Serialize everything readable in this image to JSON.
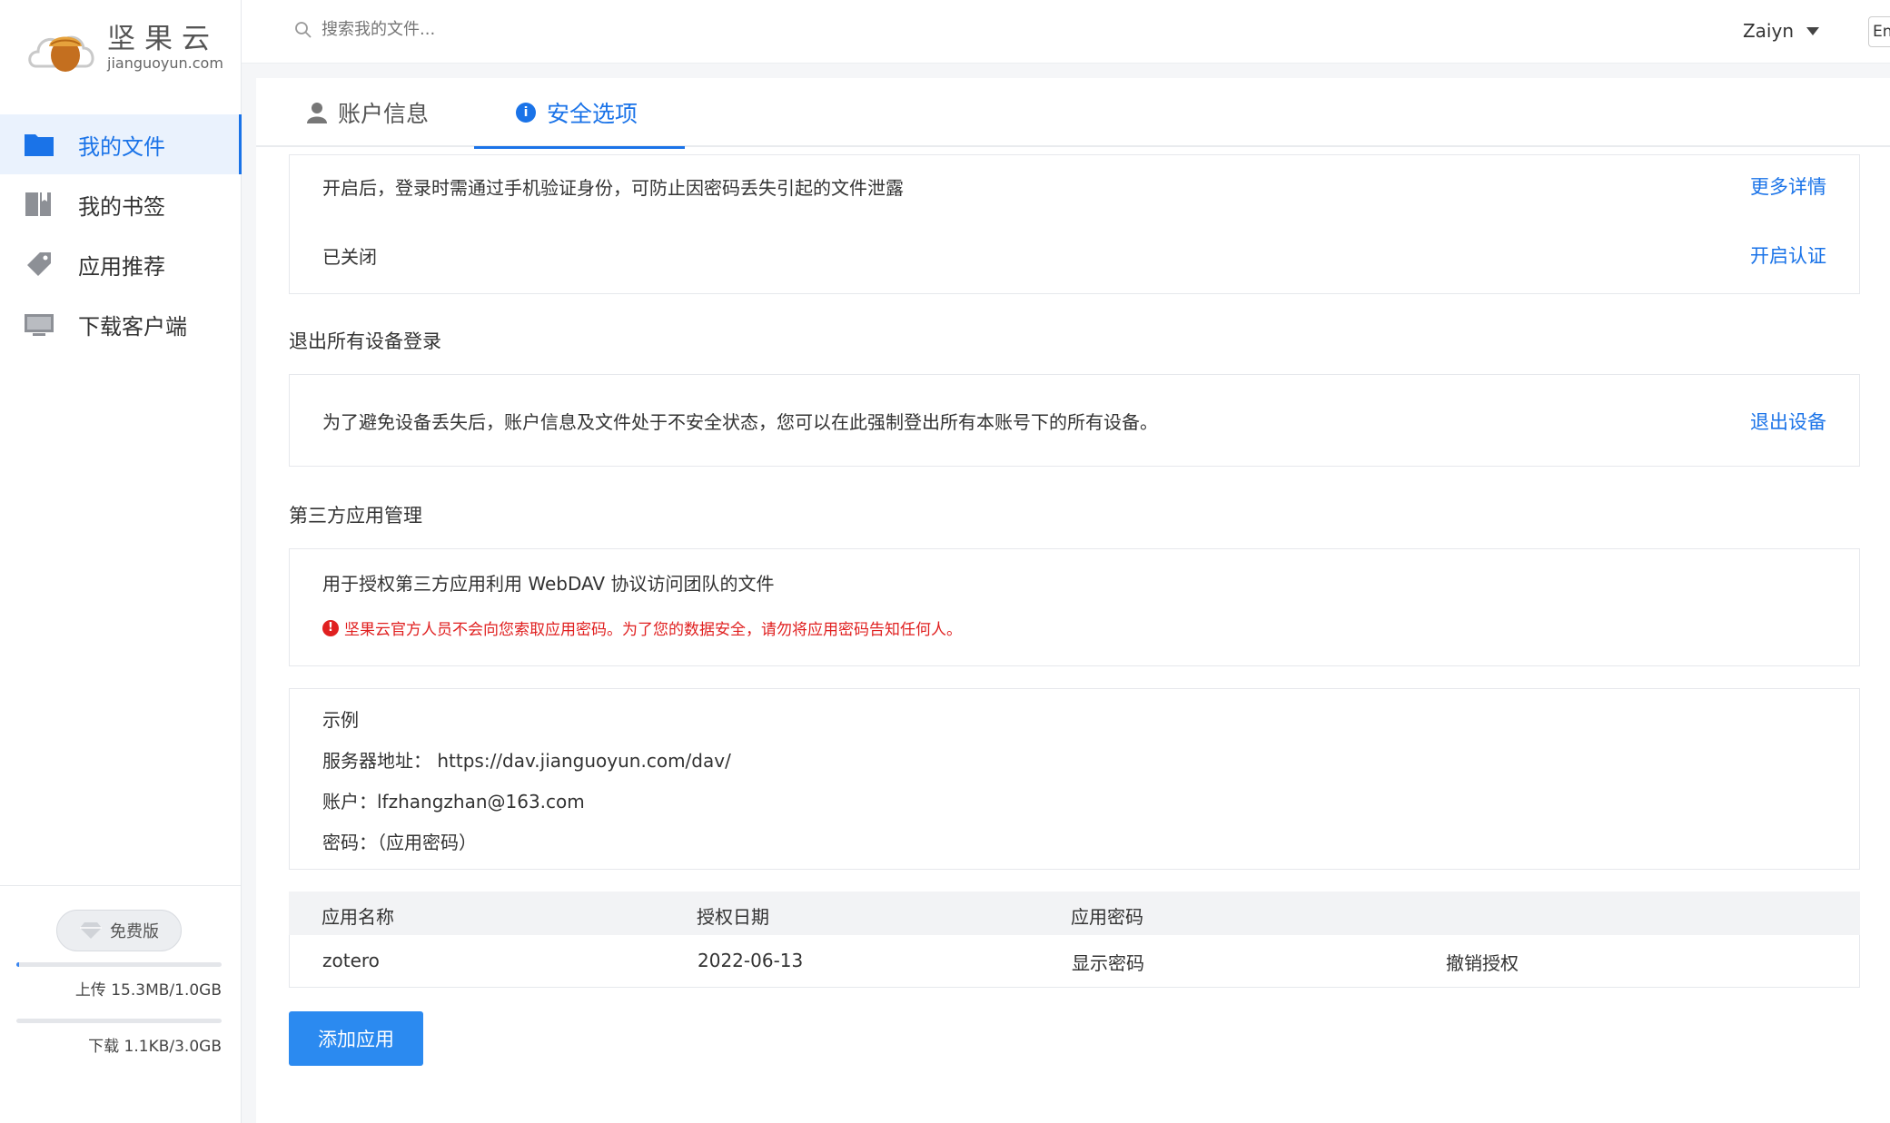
{
  "brand": {
    "name_cn": "坚果云",
    "name_en": "jianguoyun.com"
  },
  "sidebar": {
    "items": [
      {
        "label": "我的文件",
        "icon": "folder-icon",
        "active": true
      },
      {
        "label": "我的书签",
        "icon": "bookmark-icon",
        "active": false
      },
      {
        "label": "应用推荐",
        "icon": "tag-icon",
        "active": false
      },
      {
        "label": "下载客户端",
        "icon": "monitor-icon",
        "active": false
      }
    ],
    "plan_label": "免费版",
    "upload": {
      "text": "上传 15.3MB/1.0GB",
      "fraction": 0.015
    },
    "download": {
      "text": "下载 1.1KB/3.0GB",
      "fraction": 0.0
    }
  },
  "topbar": {
    "search_placeholder": "搜索我的文件...",
    "user_name": "Zaiyn",
    "lang": "En"
  },
  "tabs": [
    {
      "label": "账户信息",
      "icon": "user-icon",
      "active": false
    },
    {
      "label": "安全选项",
      "icon": "info-icon",
      "active": true
    }
  ],
  "two_factor": {
    "description": "开启后，登录时需通过手机验证身份，可防止因密码丢失引起的文件泄露",
    "more_link": "更多详情",
    "status": "已关闭",
    "enable_link": "开启认证"
  },
  "logout_all": {
    "title": "退出所有设备登录",
    "description": "为了避免设备丢失后，账户信息及文件处于不安全状态，您可以在此强制登出所有本账号下的所有设备。",
    "action": "退出设备"
  },
  "third_party": {
    "title": "第三方应用管理",
    "description": "用于授权第三方应用利用 WebDAV 协议访问团队的文件",
    "warning": "坚果云官方人员不会向您索取应用密码。为了您的数据安全，请勿将应用密码告知任何人。",
    "example": {
      "title": "示例",
      "server": "服务器地址：  https://dav.jianguoyun.com/dav/",
      "account": "账户：lfzhangzhan@163.com",
      "password": "密码：（应用密码）"
    },
    "table": {
      "headers": [
        "应用名称",
        "授权日期",
        "应用密码"
      ],
      "rows": [
        {
          "name": "zotero",
          "date": "2022-06-13",
          "show_password": "显示密码",
          "revoke": "撤销授权"
        }
      ]
    },
    "add_button": "添加应用"
  },
  "colors": {
    "accent": "#1a73e8",
    "warning": "#e02020",
    "button": "#2b8af0"
  }
}
